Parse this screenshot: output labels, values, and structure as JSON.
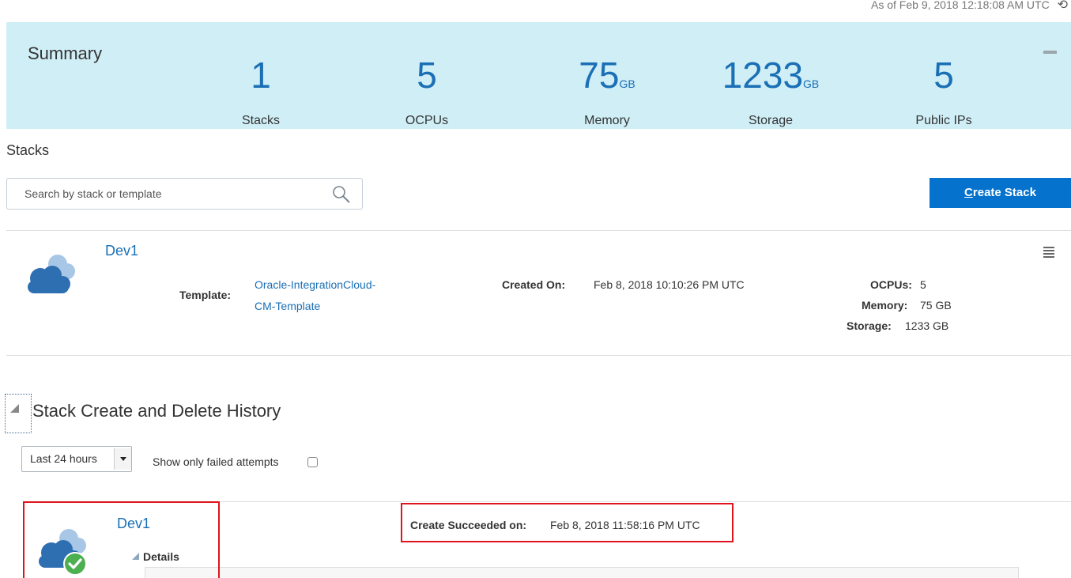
{
  "header": {
    "as_of": "As of Feb 9, 2018 12:18:08 AM UTC"
  },
  "summary": {
    "title": "Summary",
    "metrics": [
      {
        "value": "1",
        "unit": "",
        "label": "Stacks"
      },
      {
        "value": "5",
        "unit": "",
        "label": "OCPUs"
      },
      {
        "value": "75",
        "unit": "GB",
        "label": "Memory"
      },
      {
        "value": "1233",
        "unit": "GB",
        "label": "Storage"
      },
      {
        "value": "5",
        "unit": "",
        "label": "Public IPs"
      }
    ]
  },
  "stacks": {
    "title": "Stacks",
    "search_placeholder": "Search by stack or template",
    "create_button": {
      "mnemonic": "C",
      "rest": "reate Stack"
    },
    "items": [
      {
        "name": "Dev1",
        "template_label": "Template:",
        "template_line1": "Oracle-IntegrationCloud-",
        "template_line2": "CM-Template",
        "created_label": "Created On:",
        "created_value": "Feb 8, 2018 10:10:26 PM UTC",
        "ocpus_label": "OCPUs:",
        "ocpus_value": "5",
        "memory_label": "Memory:",
        "memory_value": "75 GB",
        "storage_label": "Storage:",
        "storage_value": "1233 GB"
      }
    ]
  },
  "history": {
    "title": "Stack Create and Delete History",
    "range_selected": "Last 24 hours",
    "failed_only_label": "Show only failed attempts",
    "failed_only_checked": false,
    "entries": [
      {
        "name": "Dev1",
        "details_label": "Details",
        "status_label": "Create Succeeded on:",
        "status_value": "Feb 8, 2018 11:58:16 PM UTC"
      }
    ]
  },
  "colors": {
    "summary_bg": "#cfeef6",
    "accent": "#1a6fb5",
    "button_bg": "#0572ce",
    "success": "#4caf50",
    "highlight_box": "#e0141e"
  },
  "icons": [
    "refresh-icon",
    "collapse-icon",
    "search-icon",
    "cloud-icon",
    "hamburger-menu-icon",
    "triangle-collapse-icon",
    "dropdown-arrow-icon",
    "success-check-icon"
  ]
}
